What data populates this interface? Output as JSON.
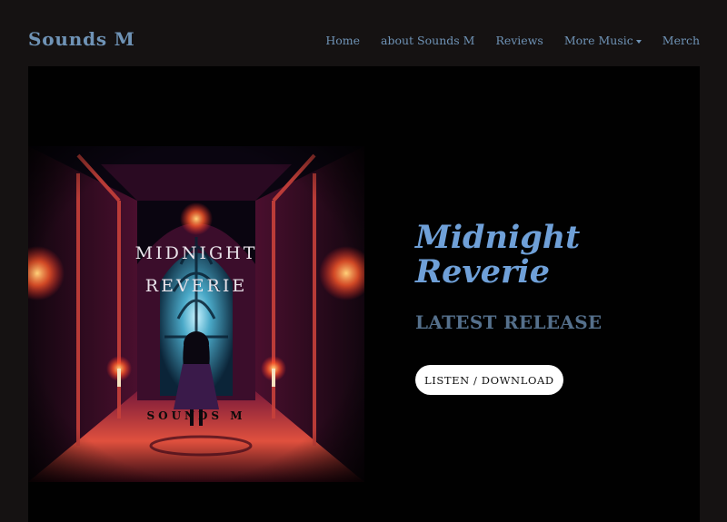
{
  "header": {
    "site_title": "Sounds M",
    "nav": [
      {
        "label": "Home"
      },
      {
        "label": "about Sounds M"
      },
      {
        "label": "Reviews"
      },
      {
        "label": "More Music",
        "has_dropdown": true
      },
      {
        "label": "Merch"
      }
    ]
  },
  "hero": {
    "cover": {
      "title_line1": "MIDNIGHT",
      "title_line2": "REVERIE",
      "artist": "SOUNDS M"
    },
    "release_title": "Midnight Reverie",
    "release_subtitle": "LATEST RELEASE",
    "cta_label": "LISTEN / DOWNLOAD"
  },
  "colors": {
    "page_bg": "#151212",
    "hero_bg": "#010101",
    "accent": "#6f93b6",
    "title_blue": "#6fa0d8",
    "subtitle": "#55708c",
    "button_bg": "#ffffff"
  },
  "icons": {
    "dropdown": "chevron-down-icon"
  }
}
